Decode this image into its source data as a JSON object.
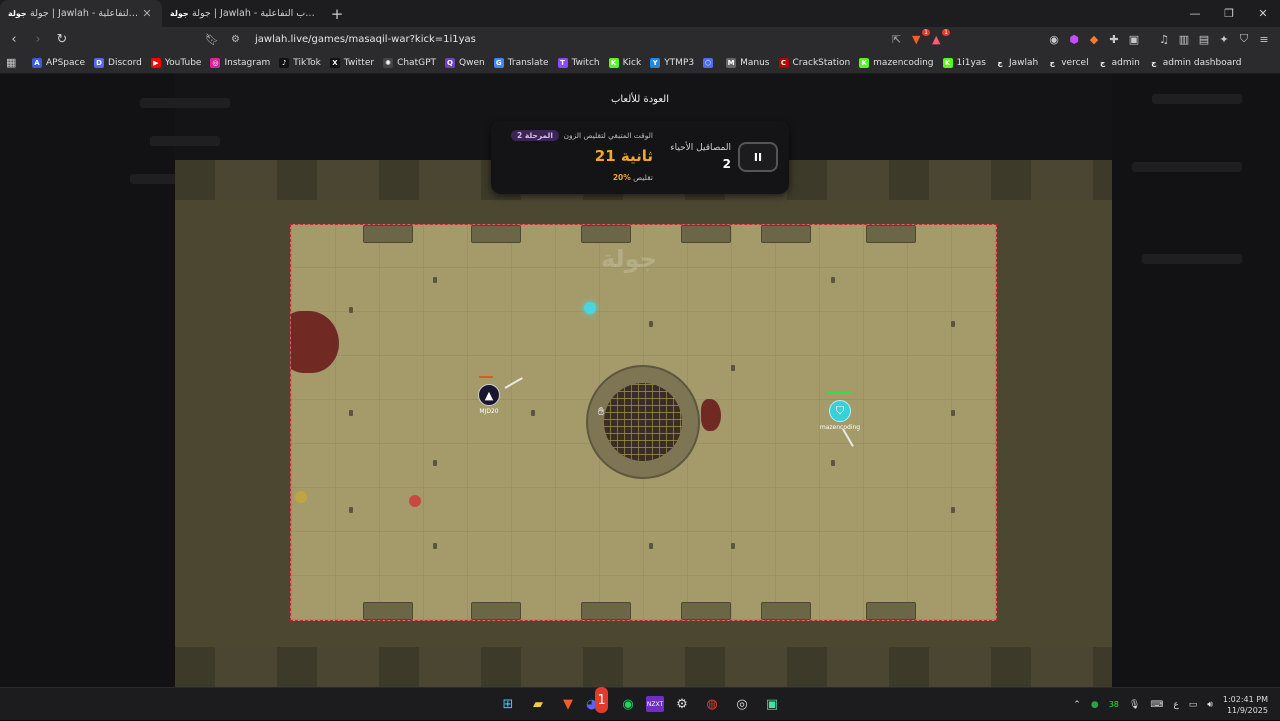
{
  "browser": {
    "tabs": [
      {
        "favicon": "جولة",
        "title": "جولة | Jawlah - منصة الألعاب التفاعلية",
        "active": true
      },
      {
        "favicon": "جولة",
        "title": "جولة | Jawlah - منصة الألعاب التفاعلية",
        "active": false
      }
    ],
    "tab_close": "✕",
    "new_tab": "+",
    "url": "jawlah.live/games/masaqil-war?kick=1i1yas",
    "brave_badge": "1",
    "rewards_badge": "1",
    "bookmarks": [
      {
        "label": "APSpace",
        "color": "#3b5bdb",
        "glyph": "A"
      },
      {
        "label": "Discord",
        "color": "#5865f2",
        "glyph": "D"
      },
      {
        "label": "YouTube",
        "color": "#ff0000",
        "glyph": "▶"
      },
      {
        "label": "Instagram",
        "color": "#d6249f",
        "glyph": "◎"
      },
      {
        "label": "TikTok",
        "color": "#111111",
        "glyph": "♪"
      },
      {
        "label": "Twitter",
        "color": "#111111",
        "glyph": "X"
      },
      {
        "label": "ChatGPT",
        "color": "#444444",
        "glyph": "✺"
      },
      {
        "label": "Qwen",
        "color": "#6f42c1",
        "glyph": "Q"
      },
      {
        "label": "Translate",
        "color": "#4285f4",
        "glyph": "G"
      },
      {
        "label": "Twitch",
        "color": "#9146ff",
        "glyph": "T"
      },
      {
        "label": "Kick",
        "color": "#53fc18",
        "glyph": "K"
      },
      {
        "label": "YTMP3",
        "color": "#1e88e5",
        "glyph": "Y"
      },
      {
        "label": "",
        "color": "#4c6ef5",
        "glyph": "⬡"
      },
      {
        "label": "Manus",
        "color": "#666666",
        "glyph": "M"
      },
      {
        "label": "CrackStation",
        "color": "#b30000",
        "glyph": "C"
      },
      {
        "label": "mazencoding",
        "color": "#53fc18",
        "glyph": "K"
      },
      {
        "label": "1i1yas",
        "color": "#53fc18",
        "glyph": "K"
      },
      {
        "label": "Jawlah",
        "color": "#2b2b2e",
        "glyph": "ج"
      },
      {
        "label": "vercel",
        "color": "#2b2b2e",
        "glyph": "ج"
      },
      {
        "label": "admin",
        "color": "#2b2b2e",
        "glyph": "ج"
      },
      {
        "label": "admin dashboard",
        "color": "#2b2b2e",
        "glyph": "ج"
      }
    ]
  },
  "game": {
    "back_label": "العودة للألعاب",
    "hud": {
      "pause_label": "II",
      "alive_label": "المصاقيل الأحياء",
      "alive_count": "2",
      "phase_badge": "المرحلة 2",
      "time_label": "الوقت المتبقي لتقليص الزون",
      "time_value": "21 ثانية",
      "shrink_label": "تقليص",
      "shrink_value": "20%"
    },
    "watermark": "جولة",
    "players": [
      {
        "name": "MJD20",
        "color": "#1a1530",
        "icon": "▲"
      },
      {
        "name": "mazencoding",
        "color": "#3ad0d8",
        "icon": "⛉"
      }
    ]
  },
  "taskbar": {
    "time": "1:02:41 PM",
    "date": "11/9/2025",
    "lang": "ع",
    "badge_count": "38",
    "discord_badge": "1"
  }
}
